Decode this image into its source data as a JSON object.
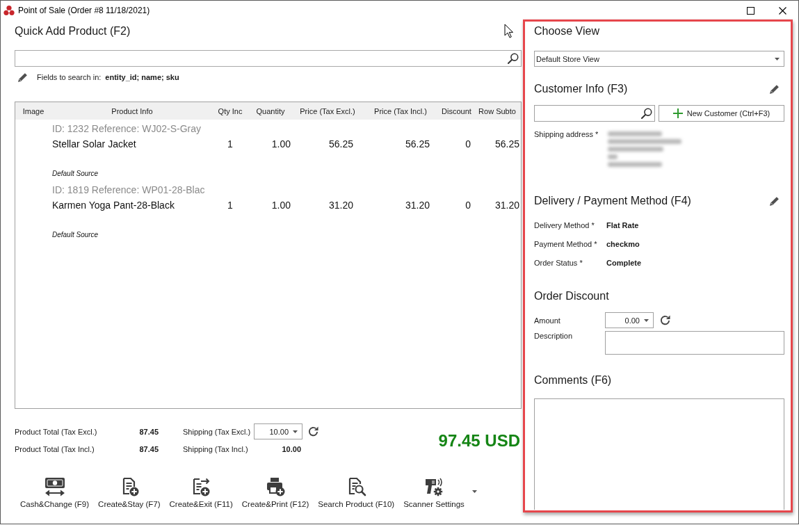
{
  "window": {
    "title": "Point of Sale (Order #8 11/18/2021)"
  },
  "quick_add": {
    "title": "Quick Add Product (F2)",
    "search_fields_label": "Fields to search in:",
    "search_fields": "entity_id; name; sku"
  },
  "table": {
    "columns": [
      "Image",
      "Product Info",
      "Qty Inc",
      "Quantity",
      "Price (Tax Excl.)",
      "Price (Tax Incl.)",
      "Discount",
      "Row Subto"
    ],
    "rows": [
      {
        "reference": "ID: 1232 Reference: WJ02-S-Gray",
        "name": "Stellar Solar Jacket",
        "qty_increment": "1",
        "quantity": "1.00",
        "price_excl": "56.25",
        "price_incl": "56.25",
        "discount": "0",
        "row_subtotal": "56.25",
        "source": "Default Source"
      },
      {
        "reference": "ID: 1819 Reference: WP01-28-Blac",
        "name": "Karmen Yoga Pant-28-Black",
        "qty_increment": "1",
        "quantity": "1.00",
        "price_excl": "31.20",
        "price_incl": "31.20",
        "discount": "0",
        "row_subtotal": "31.20",
        "source": "Default Source"
      }
    ]
  },
  "totals": {
    "product_total_excl": {
      "label": "Product Total (Tax Excl.)",
      "value": "87.45"
    },
    "shipping_excl": {
      "label": "Shipping (Tax Excl.)",
      "value": "10.00"
    },
    "product_total_incl": {
      "label": "Product Total (Tax Incl.)",
      "value": "87.45"
    },
    "shipping_incl": {
      "label": "Shipping (Tax Incl.)",
      "value": "10.00"
    },
    "grand_total": "97.45 USD"
  },
  "toolbar": [
    {
      "label": "Cash&Change (F9)",
      "dropdown": false
    },
    {
      "label": "Create&Stay (F7)",
      "dropdown": false
    },
    {
      "label": "Create&Exit (F11)",
      "dropdown": false
    },
    {
      "label": "Create&Print (F12)",
      "dropdown": false
    },
    {
      "label": "Search Product (F10)",
      "dropdown": false
    },
    {
      "label": "Scanner Settings",
      "dropdown": true
    }
  ],
  "side_panel": {
    "choose_view": {
      "title": "Choose View",
      "value": "Default Store View"
    },
    "customer_info": {
      "title": "Customer Info (F3)",
      "new_customer_button": "New Customer (Ctrl+F3)",
      "shipping_address_label": "Shipping address *",
      "shipping_address_redacted": true
    },
    "delivery_payment": {
      "title": "Delivery / Payment Method (F4)",
      "fields": [
        {
          "label": "Delivery Method *",
          "value": "Flat Rate"
        },
        {
          "label": "Payment Method *",
          "value": "checkmo"
        },
        {
          "label": "Order Status *",
          "value": "Complete"
        }
      ]
    },
    "order_discount": {
      "title": "Order Discount",
      "amount_label": "Amount",
      "amount": "0.00",
      "description_label": "Description"
    },
    "comments": {
      "title": "Comments (F6)"
    }
  }
}
